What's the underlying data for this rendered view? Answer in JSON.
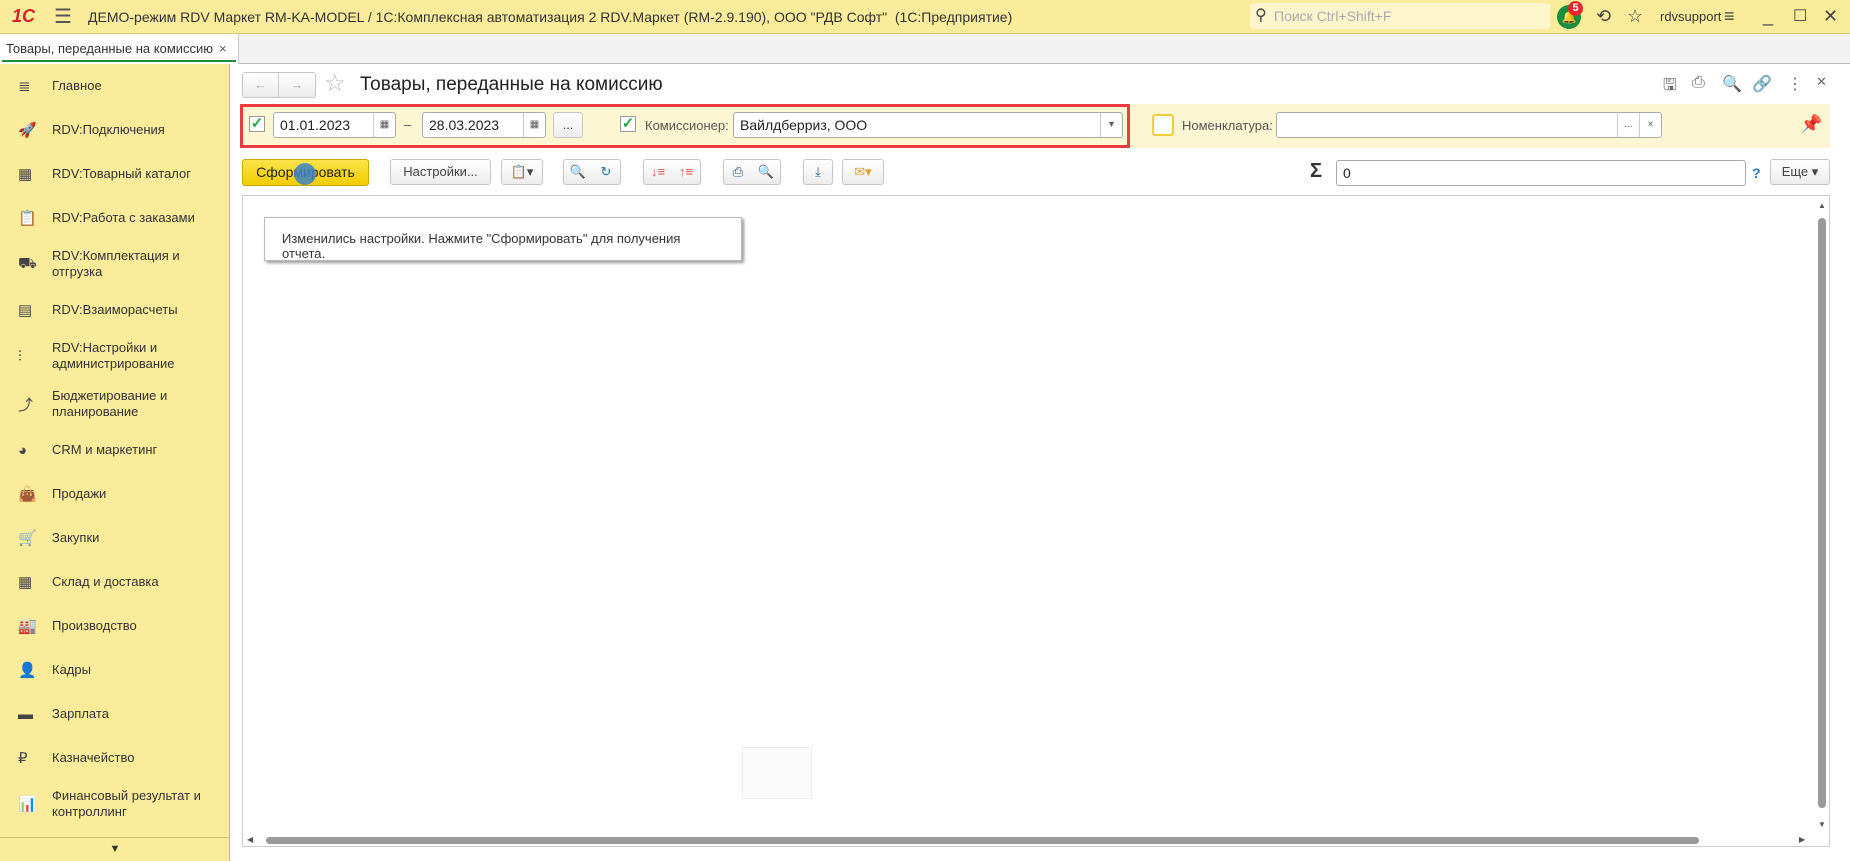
{
  "titlebar": {
    "logo": "1С",
    "title": "ДЕМО-режим RDV Маркет RM-KA-MODEL / 1С:Комплексная автоматизация 2 RDV.Маркет (RM-2.9.190), ООО \"РДВ Софт\"  (1С:Предприятие)",
    "search_placeholder": "Поиск Ctrl+Shift+F",
    "notifications": "5",
    "user": "rdvsupport"
  },
  "tab": {
    "label": "Товары, переданные на комиссию",
    "close": "×"
  },
  "sidebar": {
    "items": [
      {
        "label": "Главное",
        "icon": "menu-icon",
        "glyph": "≣"
      },
      {
        "label": "RDV:Подключения",
        "icon": "rocket-icon",
        "glyph": "🚀"
      },
      {
        "label": "RDV:Товарный каталог",
        "icon": "grid-icon",
        "glyph": "▦"
      },
      {
        "label": "RDV:Работа с заказами",
        "icon": "clipboard-icon",
        "glyph": "📋"
      },
      {
        "label": "RDV:Комплектация и отгрузка",
        "icon": "cart-dolly-icon",
        "glyph": "⛟"
      },
      {
        "label": "RDV:Взаиморасчеты",
        "icon": "calculator-icon",
        "glyph": "▤"
      },
      {
        "label": "RDV:Настройки и администрирование",
        "icon": "sliders-icon",
        "glyph": "⫶"
      },
      {
        "label": "Бюджетирование и планирование",
        "icon": "budget-chart-icon",
        "glyph": "⤴"
      },
      {
        "label": "CRM и маркетинг",
        "icon": "pie-chart-icon",
        "glyph": "◕"
      },
      {
        "label": "Продажи",
        "icon": "shopping-bag-icon",
        "glyph": "👜"
      },
      {
        "label": "Закупки",
        "icon": "cart-icon",
        "glyph": "🛒"
      },
      {
        "label": "Склад и доставка",
        "icon": "warehouse-icon",
        "glyph": "▦"
      },
      {
        "label": "Производство",
        "icon": "factory-icon",
        "glyph": "🏭"
      },
      {
        "label": "Кадры",
        "icon": "person-icon",
        "glyph": "👤"
      },
      {
        "label": "Зарплата",
        "icon": "card-icon",
        "glyph": "▬"
      },
      {
        "label": "Казначейство",
        "icon": "ruble-icon",
        "glyph": "₽"
      },
      {
        "label": "Финансовый результат и контроллинг",
        "icon": "bar-chart-icon",
        "glyph": "📊"
      }
    ],
    "more": "▼"
  },
  "form": {
    "title": "Товары, переданные на комиссию",
    "filters": {
      "date_from": "01.01.2023",
      "date_to": "28.03.2023",
      "dash": "–",
      "period_button": "...",
      "commissioner_label": "Комиссионер:",
      "commissioner_value": "Вайлдберриз, ООО",
      "nomenclature_label": "Номенклатура:",
      "nomenclature_value": "",
      "select_button": "...",
      "clear_button": "×"
    },
    "toolbar": {
      "generate": "Сформировать",
      "settings": "Настройки...",
      "sum_symbol": "Σ",
      "sum_value": "0",
      "help": "?",
      "more": "Еще"
    },
    "message": "Изменились настройки. Нажмите \"Сформировать\" для получения отчета."
  },
  "colors": {
    "accent_yellow": "#fbec9c",
    "highlight_red": "#ee3b3f",
    "check_green": "#2aa54a"
  }
}
